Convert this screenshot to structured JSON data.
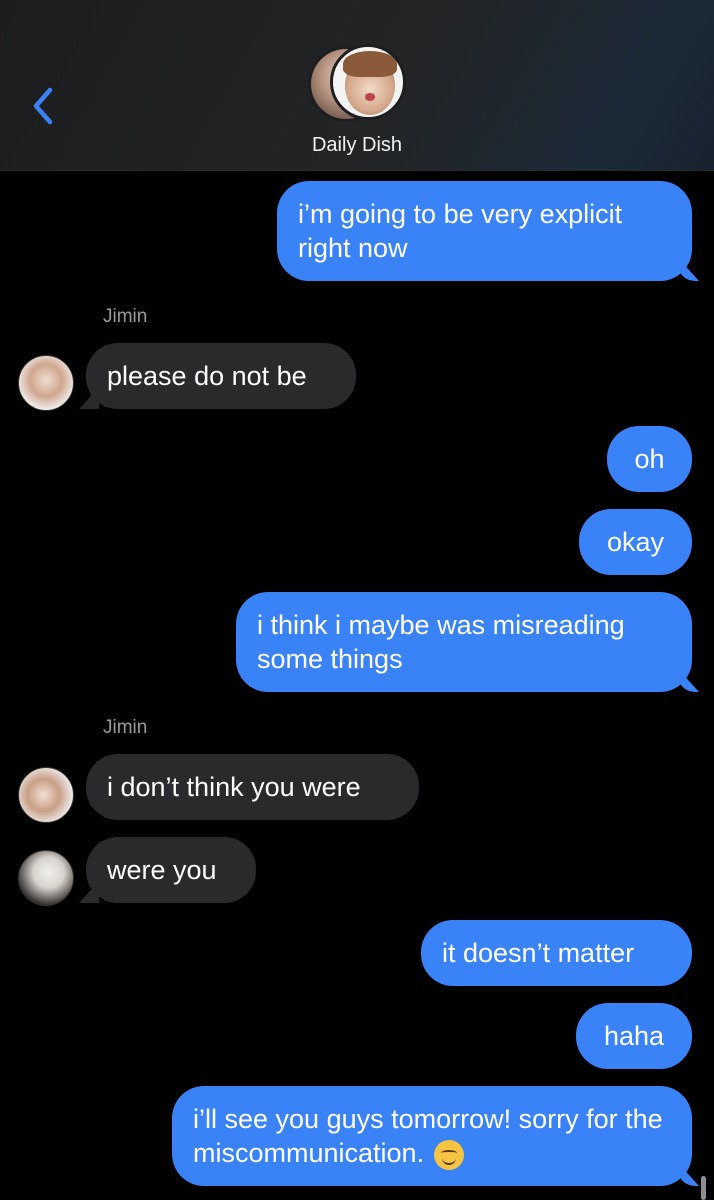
{
  "header": {
    "chat_title": "Daily Dish",
    "back_icon": "chevron-left-icon",
    "accent_color": "#3a82f7"
  },
  "messages": [
    {
      "direction": "outgoing",
      "text": "i’m going to be very explicit right now"
    },
    {
      "direction": "incoming",
      "sender": "Jimin",
      "text": "please do not be"
    },
    {
      "direction": "outgoing",
      "text": "oh"
    },
    {
      "direction": "outgoing",
      "text": "okay"
    },
    {
      "direction": "outgoing",
      "text": "i think i maybe was misreading some things"
    },
    {
      "direction": "incoming",
      "sender": "Jimin",
      "text": "i don’t think you were"
    },
    {
      "direction": "incoming",
      "text": "were you"
    },
    {
      "direction": "outgoing",
      "text": "it doesn’t matter"
    },
    {
      "direction": "outgoing",
      "text": "haha"
    },
    {
      "direction": "outgoing",
      "text": "i’ll see you guys tomorrow! sorry for the miscommunication.",
      "emoji": "smiling-face-emoji"
    }
  ],
  "colors": {
    "outgoing_bubble": "#3a82f7",
    "incoming_bubble": "#2a2a2c",
    "background": "#000000"
  }
}
